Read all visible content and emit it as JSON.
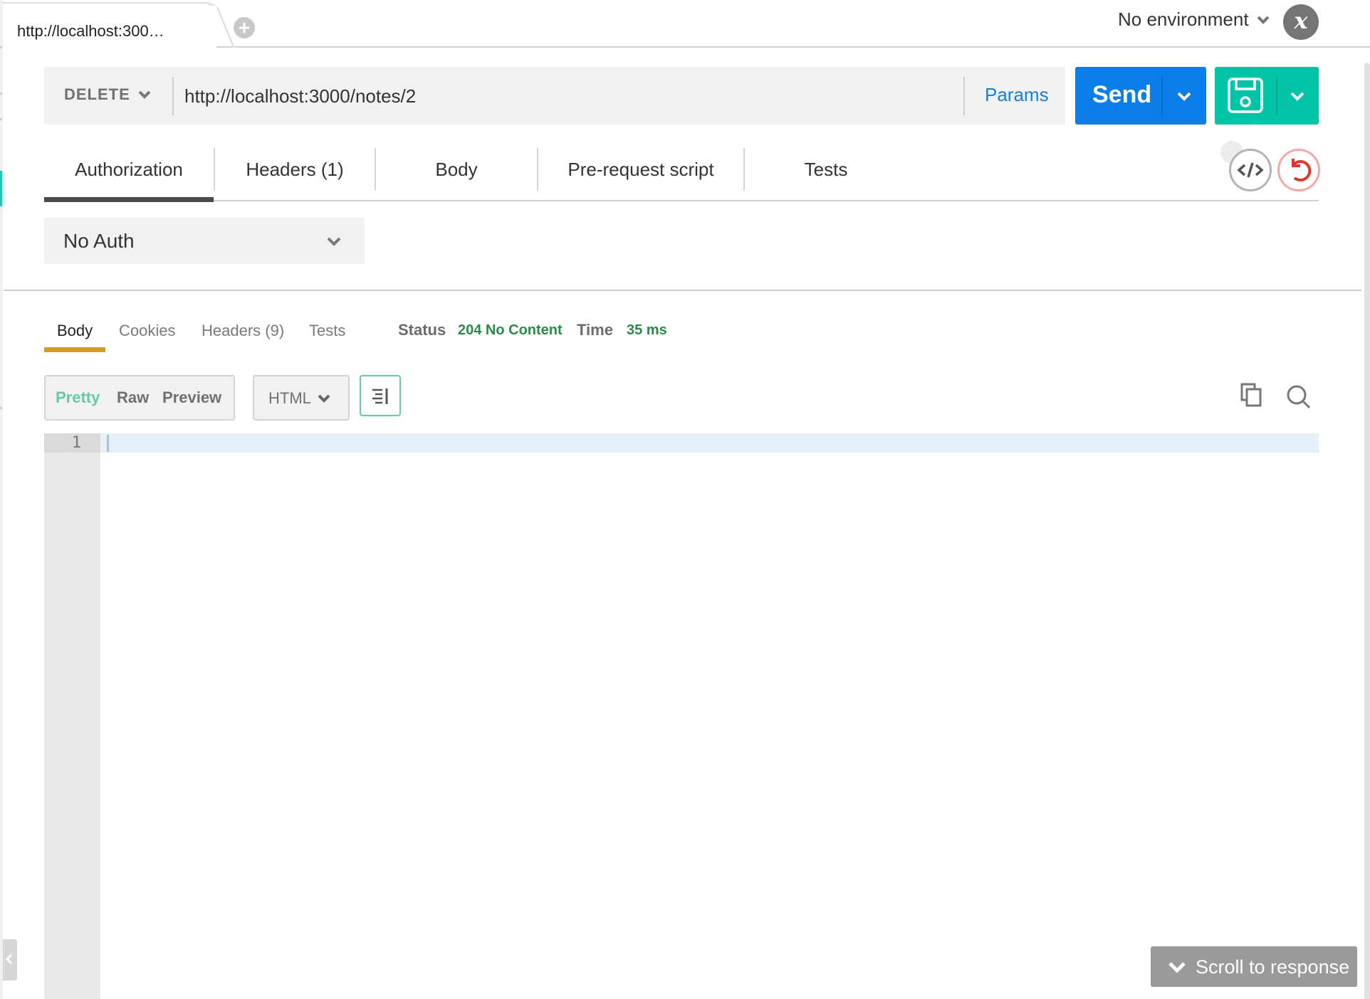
{
  "tabs": {
    "open": [
      {
        "label": "http://localhost:300…",
        "active": true
      }
    ],
    "add_icon": "plus-circle-icon"
  },
  "environment": {
    "selected": "No environment",
    "options_icon": "chevron-down-icon",
    "manage_icon": "variable-x-icon"
  },
  "request": {
    "method": "DELETE",
    "url": "http://localhost:3000/notes/2",
    "params_label": "Params",
    "send_label": "Send",
    "tabs": [
      {
        "label": "Authorization",
        "active": true
      },
      {
        "label": "Headers (1)",
        "active": false
      },
      {
        "label": "Body",
        "active": false
      },
      {
        "label": "Pre-request script",
        "active": false
      },
      {
        "label": "Tests",
        "active": false
      }
    ],
    "auth": {
      "selected": "No Auth"
    }
  },
  "response": {
    "tabs": [
      {
        "label": "Body",
        "active": true
      },
      {
        "label": "Cookies",
        "active": false
      },
      {
        "label": "Headers (9)",
        "active": false
      },
      {
        "label": "Tests",
        "active": false
      }
    ],
    "status_label": "Status",
    "status_value": "204 No Content",
    "time_label": "Time",
    "time_value": "35 ms",
    "formats": [
      {
        "label": "Pretty",
        "active": true
      },
      {
        "label": "Raw",
        "active": false
      },
      {
        "label": "Preview",
        "active": false
      }
    ],
    "language": "HTML",
    "editor": {
      "lines": [
        {
          "number": "1",
          "content": ""
        }
      ]
    }
  },
  "scroll_to_response_label": "Scroll to response",
  "colors": {
    "send": "#0b7de9",
    "save": "#00c4a6",
    "status_ok": "#2a8a4a",
    "response_tab_accent": "#d3a01b",
    "params_link": "#1a7fd6",
    "pretty_active": "#67c9a8"
  }
}
